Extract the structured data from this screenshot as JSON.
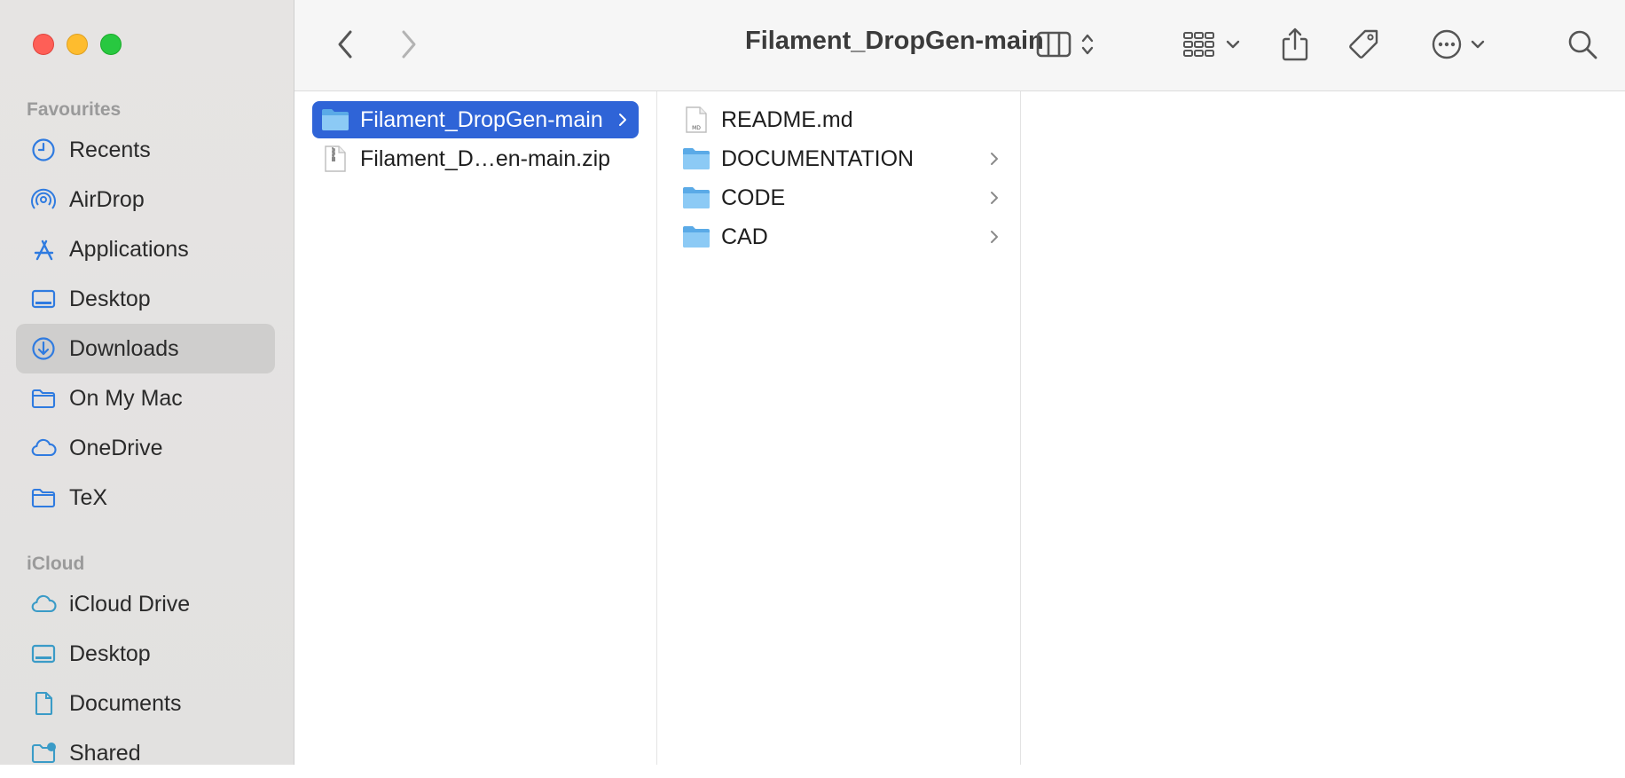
{
  "window": {
    "title": "Filament_DropGen-main"
  },
  "sidebar": {
    "favourites_title": "Favourites",
    "favourites": [
      {
        "label": "Recents",
        "icon": "clock-icon"
      },
      {
        "label": "AirDrop",
        "icon": "airdrop-icon"
      },
      {
        "label": "Applications",
        "icon": "applications-icon"
      },
      {
        "label": "Desktop",
        "icon": "desktop-icon"
      },
      {
        "label": "Downloads",
        "icon": "download-icon",
        "active": true
      },
      {
        "label": "On My Mac",
        "icon": "folder-icon"
      },
      {
        "label": "OneDrive",
        "icon": "cloud-icon"
      },
      {
        "label": "TeX",
        "icon": "folder-icon"
      }
    ],
    "icloud_title": "iCloud",
    "icloud": [
      {
        "label": "iCloud Drive",
        "icon": "cloud-icon"
      },
      {
        "label": "Desktop",
        "icon": "desktop-icon"
      },
      {
        "label": "Documents",
        "icon": "document-icon"
      },
      {
        "label": "Shared",
        "icon": "shared-folder-icon"
      }
    ]
  },
  "toolbar": {
    "back": "chevron-left-icon",
    "forward": "chevron-right-icon",
    "view": "column-view-icon",
    "group": "grid-group-icon",
    "share": "share-icon",
    "tag": "tag-icon",
    "more": "ellipsis-circle-icon",
    "search": "search-icon"
  },
  "columns": {
    "col1": [
      {
        "name": "Filament_DropGen-main",
        "type": "folder",
        "selected": true
      },
      {
        "name": "Filament_D…en-main.zip",
        "type": "zip"
      }
    ],
    "col2": [
      {
        "name": "README.md",
        "type": "md"
      },
      {
        "name": "DOCUMENTATION",
        "type": "folder"
      },
      {
        "name": "CODE",
        "type": "folder"
      },
      {
        "name": "CAD",
        "type": "folder"
      }
    ]
  },
  "colors": {
    "accent": "#2f64d7",
    "sidebar_icon": "#2f7be0",
    "folder": "#6fb6ec",
    "sidebar_bg": "#e4e3e2",
    "active_row": "#cfcecd"
  }
}
